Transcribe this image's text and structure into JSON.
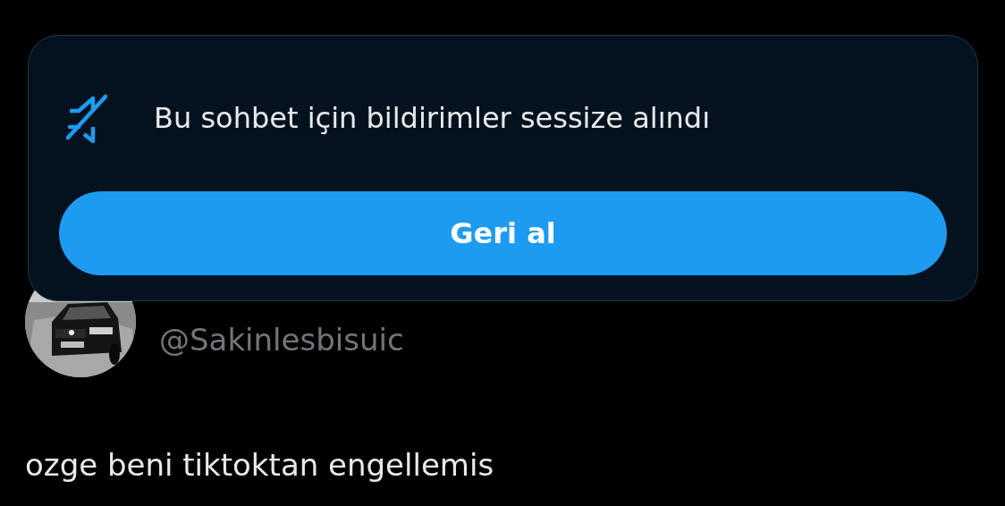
{
  "tweet": {
    "handle": "@Sakinlesbisuic",
    "text": "ozge beni tiktoktan engellemis"
  },
  "toast": {
    "message": "Bu sohbet için bildirimler sessize alındı",
    "button": "Geri al"
  }
}
